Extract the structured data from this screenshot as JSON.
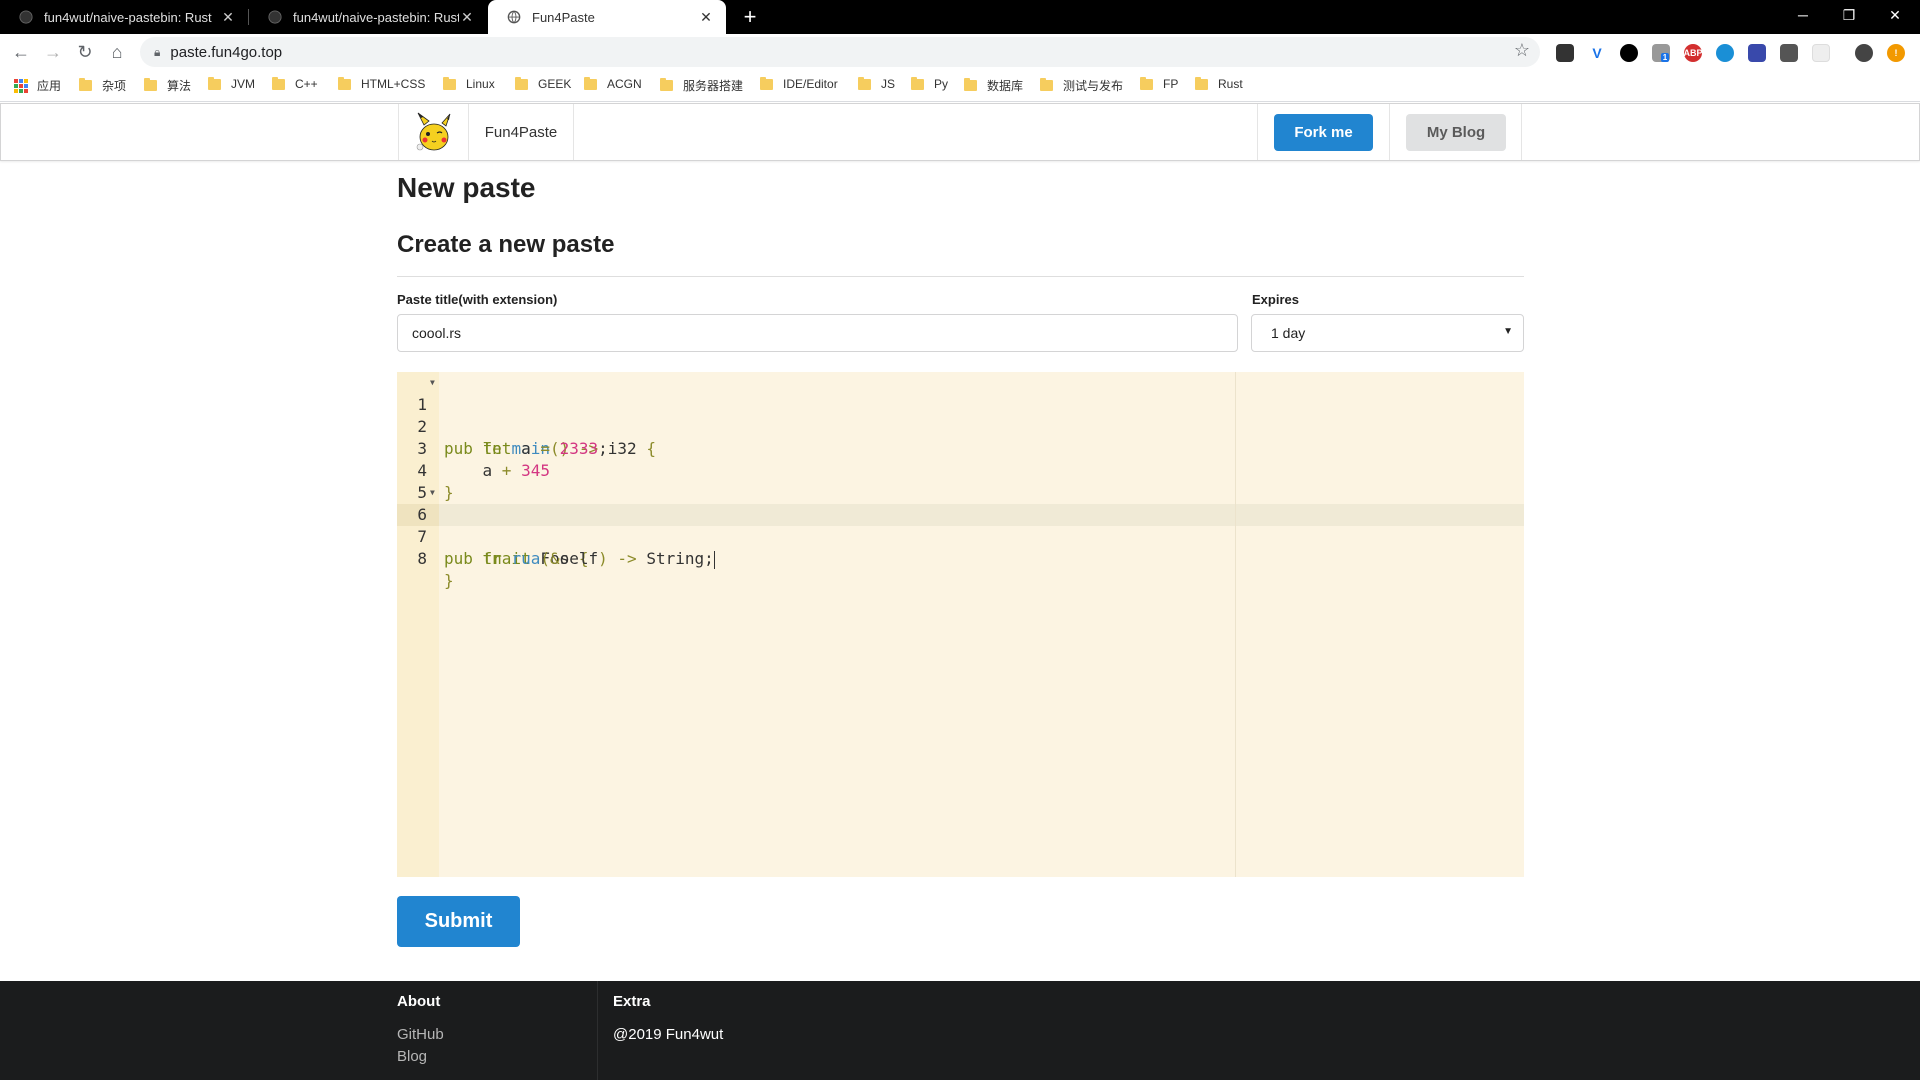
{
  "browser": {
    "tabs": [
      {
        "title": "fun4wut/naive-pastebin: Rust",
        "active": false
      },
      {
        "title": "fun4wut/naive-pastebin: Rust",
        "active": false
      },
      {
        "title": "Fun4Paste",
        "active": true
      }
    ],
    "url": "paste.fun4go.top",
    "bookmarks": {
      "apps": "应用",
      "folders": [
        "杂项",
        "算法",
        "JVM",
        "C++",
        "HTML+CSS",
        "Linux",
        "GEEK",
        "ACGN",
        "服务器搭建",
        "IDE/Editor",
        "JS",
        "Py",
        "数据库",
        "测试与发布",
        "FP",
        "Rust"
      ]
    },
    "extension_badge": "1",
    "abp_label": "ABP"
  },
  "site_nav": {
    "brand": "Fun4Paste",
    "fork_label": "Fork me",
    "blog_label": "My Blog"
  },
  "page": {
    "heading": "New paste",
    "subheading": "Create a new paste",
    "title_label": "Paste title(with extension)",
    "title_value": "coool.rs",
    "expires_label": "Expires",
    "expires_value": "1 day",
    "submit_label": "Submit"
  },
  "editor": {
    "line_numbers": [
      "1",
      "2",
      "3",
      "4",
      "5",
      "6",
      "7",
      "8"
    ],
    "active_line": 7,
    "lines": [
      "pub fn main() -> i32 {",
      "    let a = 2333;",
      "    a + 345",
      "}",
      "",
      "pub trait Foo {",
      "    fn rua(&self) -> String;",
      "}"
    ]
  },
  "footer": {
    "about_heading": "About",
    "github": "GitHub",
    "blog": "Blog",
    "extra_heading": "Extra",
    "copyright": "@2019 Fun4wut"
  },
  "colors": {
    "primary": "#2185d0",
    "editor_bg": "#fcf4e2",
    "footer_bg": "#1b1c1d"
  }
}
